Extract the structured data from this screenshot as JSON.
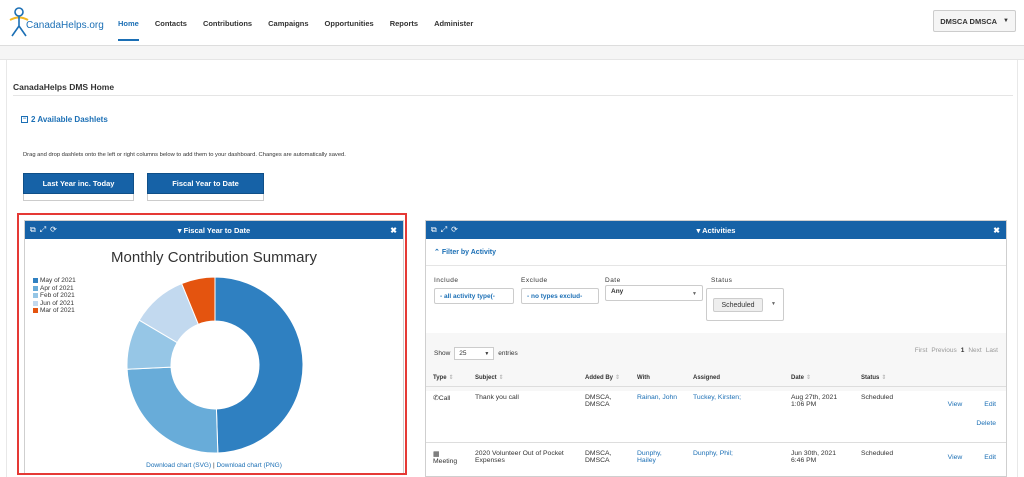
{
  "brand": {
    "name": "CanadaHelps.org"
  },
  "nav": {
    "items": [
      {
        "label": "Home",
        "active": true
      },
      {
        "label": "Contacts"
      },
      {
        "label": "Contributions"
      },
      {
        "label": "Campaigns"
      },
      {
        "label": "Opportunities"
      },
      {
        "label": "Reports"
      },
      {
        "label": "Administer"
      }
    ],
    "user": "DMSCA DMSCA"
  },
  "page": {
    "title": "CanadaHelps DMS Home",
    "available_dashlets": "2 Available Dashlets",
    "help": "Drag and drop dashlets onto the left or right columns below to add them to your dashboard. Changes are automatically saved.",
    "dashlet_buttons": [
      "Last Year inc. Today",
      "Fiscal Year to Date"
    ]
  },
  "left_panel": {
    "title": "Fiscal Year to Date",
    "chart_title": "Monthly Contribution Summary",
    "download_svg": "Download chart (SVG)",
    "separator": " | ",
    "download_png": "Download chart (PNG)"
  },
  "chart_data": {
    "type": "pie",
    "title": "Monthly Contribution Summary",
    "donut": true,
    "legend_position": "top-left",
    "categories": [
      "May of 2021",
      "Apr of 2021",
      "Feb of 2021",
      "Jun of 2021",
      "Mar of 2021"
    ],
    "values": [
      48,
      24,
      9,
      10,
      6
    ],
    "colors": [
      "#2f80c1",
      "#68acd9",
      "#96c6e6",
      "#c2d9ef",
      "#e4540f"
    ]
  },
  "right_panel": {
    "title": "Activities",
    "filter_toggle": "Filter by Activity",
    "filters": {
      "include_label": "Include",
      "include_value": "- all activity type(-",
      "exclude_label": "Exclude",
      "exclude_value": "- no types exclud-",
      "date_label": "Date",
      "date_value": "Any",
      "status_label": "Status",
      "status_value": "Scheduled"
    },
    "show_label": "Show",
    "entries_value": "25",
    "entries_label": "entries",
    "pager": {
      "first": "First",
      "previous": "Previous",
      "current": "1",
      "next": "Next",
      "last": "Last"
    },
    "columns": [
      "Type",
      "Subject",
      "Added By",
      "With",
      "Assigned",
      "Date",
      "Status"
    ],
    "rows": [
      {
        "type": "Call",
        "subject": "Thank you call",
        "added_by_1": "DMSCA,",
        "added_by_2": "DMSCA",
        "with_1": "Rainan, John",
        "with_2": "",
        "assigned": "Tuckey, Kirsten;",
        "date_1": "Aug 27th, 2021",
        "date_2": "1:06 PM",
        "status": "Scheduled",
        "view": "View",
        "edit": "Edit",
        "delete": "Delete"
      },
      {
        "type": "Meeting",
        "subject": "2020 Volunteer Out of Pocket Expenses",
        "added_by_1": "DMSCA,",
        "added_by_2": "DMSCA",
        "with_1": "Dunphy,",
        "with_2": "Hailey",
        "assigned": "Dunphy, Phil;",
        "date_1": "Jun 30th, 2021",
        "date_2": "6:46 PM",
        "status": "Scheduled",
        "view": "View",
        "edit": "Edit"
      }
    ]
  }
}
